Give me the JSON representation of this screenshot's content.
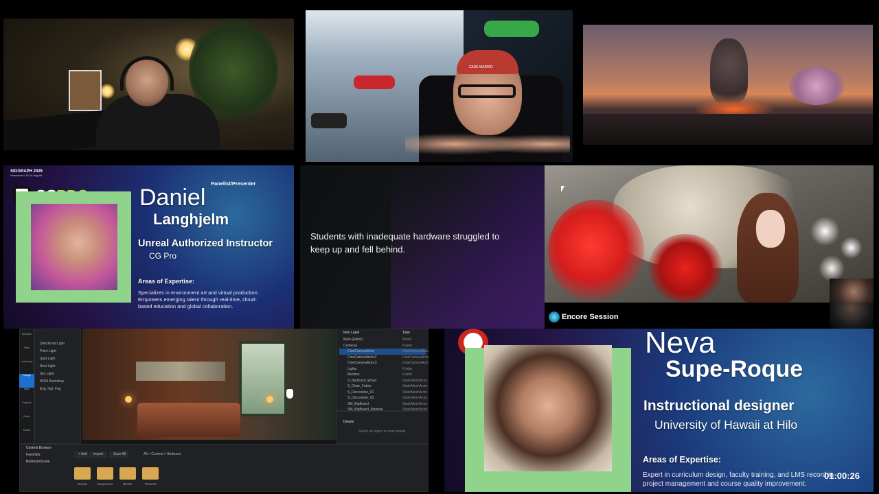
{
  "bio1": {
    "event_logo": "SIGGRAPH 2025",
    "event_sub": "Vancouver+ 10-14 August",
    "brand": "CG",
    "brand_accent": "PRO",
    "role": "Panelist/Presenter",
    "first_name": "Daniel",
    "last_name": "Langhjelm",
    "title": "Unreal Authorized Instructor",
    "org": "CG Pro",
    "expertise_heading": "Areas of Expertise:",
    "expertise_text": "Specializes in environment art and virtual production. Empowers emerging talent through real-time, cloud-based education and global collaboration."
  },
  "quote": {
    "text": "Students with inadequate hardware struggled to keep up and fell behind."
  },
  "encore": {
    "label": "Encore Session"
  },
  "cam2": {
    "cap_text": "CASE MADRID"
  },
  "editor": {
    "outliner_items": [
      "Directional Light",
      "Point Light",
      "Spot Light",
      "Rect Light",
      "Sky Light",
      "HDRI Backdrop",
      "Exp. Hgt. Fog"
    ],
    "side_icons": [
      "Selection",
      "Paint",
      "Landscape",
      "Foliage",
      "Mesh",
      "Fracture",
      "Brush",
      "Modes"
    ],
    "tree_header": "Item Label",
    "tree_type_header": "Type",
    "tree_items": [
      "Main (Editor)",
      "Cameras",
      "CineCameraActor",
      "CineCameraActor2",
      "CineCameraActor3",
      "Lights",
      "Meshes",
      "S_Bedroom_Wood",
      "S_Chair_Fabric",
      "S_Decorative_01",
      "S_Decorative_02",
      "SM_BigBoard",
      "SM_BigBoard_Material"
    ],
    "tree_types": [
      "World",
      "Folder",
      "CineCameraActor",
      "CineCameraActor",
      "CineCameraActor",
      "Folder",
      "Folder",
      "StaticMeshActor",
      "StaticMeshActor",
      "StaticMeshActor",
      "StaticMeshActor",
      "StaticMeshActor",
      "StaticMeshActor"
    ],
    "details_label": "Details",
    "details_empty": "Select an object to view details.",
    "content_browser": "Content Browser",
    "add_label": "+ Add",
    "import_label": "Import",
    "save_label": "Save All",
    "breadcrumb": "All > Content > Bedroom",
    "favorites": "Favorites",
    "folders_root": "BedroomScene",
    "folders": [
      "Decals",
      "Sequences",
      "Blocks",
      "Textures"
    ]
  },
  "bio2": {
    "first_name": "Neva",
    "last_name": "Supe-Roque",
    "title": "Instructional designer",
    "org": "University of Hawaii at Hilo",
    "expertise_heading": "Areas of Expertise:",
    "expertise_text": "Expert in curriculum design, faculty training, and LMS record in project management and course quality improvement."
  },
  "timer": "01:00:26",
  "colors": {
    "frame_green": "#8fd48a",
    "brand_accent": "#a6e04a",
    "folder": "#d7a752"
  }
}
